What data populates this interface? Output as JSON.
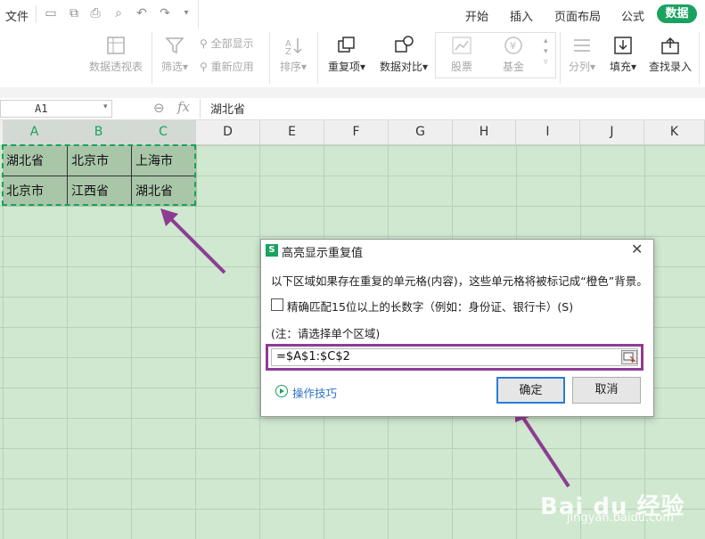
{
  "menubar": {
    "file": "文件",
    "tabs": [
      "开始",
      "插入",
      "页面布局",
      "公式"
    ],
    "active_tab": "数据"
  },
  "toolbar": {
    "pivot": "数据透视表",
    "filter": "筛选",
    "show_all": "全部显示",
    "reapply": "重新应用",
    "sort": "排序",
    "duplicates": "重复项",
    "compare": "数据对比",
    "stock": "股票",
    "fund": "基金",
    "split": "分列",
    "fill": "填充",
    "lookup": "查找录入"
  },
  "formula_bar": {
    "name_box": "A1",
    "fx": "fx",
    "value": "湖北省"
  },
  "columns": [
    "A",
    "B",
    "C",
    "D",
    "E",
    "F",
    "G",
    "H",
    "I",
    "J",
    "K"
  ],
  "cells": {
    "r1": [
      "湖北省",
      "北京市",
      "上海市"
    ],
    "r2": [
      "北京市",
      "江西省",
      "湖北省"
    ]
  },
  "dialog": {
    "title": "高亮显示重复值",
    "description": "以下区域如果存在重复的单元格(内容)，这些单元格将被标记成“橙色”背景。",
    "checkbox_label": "精确匹配15位以上的长数字（例如：身份证、银行卡）(S)",
    "note": "(注：请选择单个区域)",
    "range_value": "=$A$1:$C$2",
    "tips": "操作技巧",
    "ok": "确定",
    "cancel": "取消"
  },
  "watermark": {
    "brand": "Bai du 经验",
    "url": "jingyan.baidu.com"
  },
  "colors": {
    "accent": "#1aa260",
    "annotation": "#8e3c93",
    "sheet_bg": "#cfe8cf"
  }
}
